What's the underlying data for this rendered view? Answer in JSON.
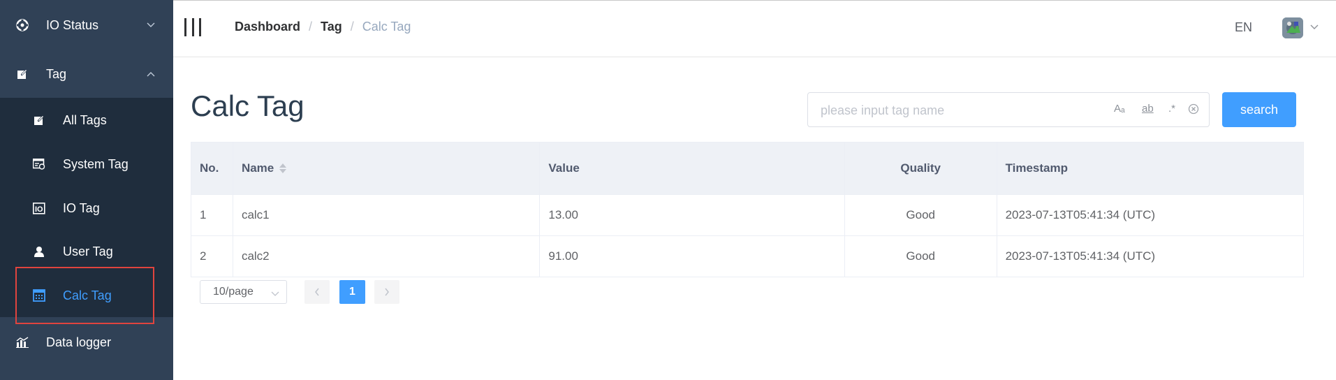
{
  "sidebar": {
    "io_status": {
      "label": "IO Status",
      "icon": "io-status-icon"
    },
    "tag": {
      "label": "Tag",
      "icon": "edit-icon"
    },
    "sub_items": [
      {
        "label": "All Tags",
        "icon": "edit-icon"
      },
      {
        "label": "System Tag",
        "icon": "system-tag-icon"
      },
      {
        "label": "IO Tag",
        "icon": "io-tag-icon"
      },
      {
        "label": "User Tag",
        "icon": "user-icon"
      },
      {
        "label": "Calc Tag",
        "icon": "calculator-icon",
        "active": true
      }
    ],
    "data_logger": {
      "label": "Data logger",
      "icon": "chart-icon"
    }
  },
  "breadcrumb": {
    "items": [
      "Dashboard",
      "Tag",
      "Calc Tag"
    ],
    "separator": "/"
  },
  "header": {
    "language": "EN"
  },
  "page": {
    "title": "Calc Tag"
  },
  "search": {
    "placeholder": "please input tag name",
    "options": [
      "Aₐ",
      "ab",
      ".*"
    ],
    "button_label": "search"
  },
  "table": {
    "columns": [
      "No.",
      "Name",
      "Value",
      "Quality",
      "Timestamp"
    ],
    "rows": [
      {
        "no": "1",
        "name": "calc1",
        "value": "13.00",
        "quality": "Good",
        "timestamp": "2023-07-13T05:41:34 (UTC)"
      },
      {
        "no": "2",
        "name": "calc2",
        "value": "91.00",
        "quality": "Good",
        "timestamp": "2023-07-13T05:41:34 (UTC)"
      }
    ]
  },
  "pagination": {
    "page_size": "10/page",
    "current_page": "1"
  },
  "colors": {
    "sidebar_bg": "#304156",
    "submenu_bg": "#1f2d3d",
    "accent": "#409eff",
    "highlight_border": "#e0443e"
  }
}
